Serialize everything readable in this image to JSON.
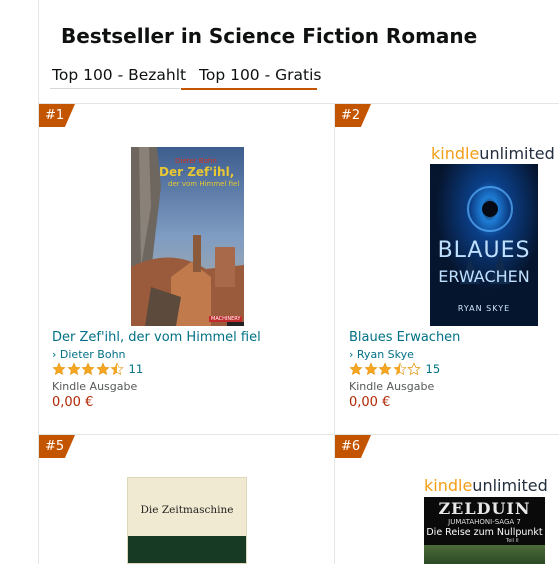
{
  "heading": "Bestseller in Science Fiction Romane",
  "tabs": [
    {
      "label": "Top 100 - Bezahlt",
      "active": false
    },
    {
      "label": "Top 100 - Gratis",
      "active": true
    }
  ],
  "accent_color": "#c45500",
  "link_color": "#007185",
  "price_color": "#b12704",
  "kindle_unlimited": {
    "kindle": "kindle",
    "unlimited": "unlimited"
  },
  "products": [
    {
      "rank": "#1",
      "cover": {
        "author_top": "Dieter Bohn",
        "title_line1": "Der Zef'ihl,",
        "title_line2": "der vom Himmel fiel",
        "publisher": "MACHINERY"
      },
      "title": "Der Zef'ihl, der vom Himmel fiel",
      "author": "› Dieter Bohn",
      "rating": 4.5,
      "rating_count": "11",
      "format": "Kindle Ausgabe",
      "price": "0,00 €"
    },
    {
      "rank": "#2",
      "cover": {
        "title_line1": "BLAUES",
        "title_line2": "ERWACHEN",
        "author_bottom": "RYAN SKYE"
      },
      "title": "Blaues Erwachen",
      "author": "› Ryan Skye",
      "rating": 3.5,
      "rating_count": "15",
      "format": "Kindle Ausgabe",
      "price": "0,00 €"
    },
    {
      "rank": "#5",
      "cover": {
        "title": "Die Zeitmaschine"
      }
    },
    {
      "rank": "#6",
      "cover": {
        "title_line1": "ZELDUIN",
        "subtitle": "JUMATAHONI-SAGA 7",
        "title_line2": "Die Reise zum Nullpunkt",
        "small": "Teil II"
      }
    }
  ]
}
